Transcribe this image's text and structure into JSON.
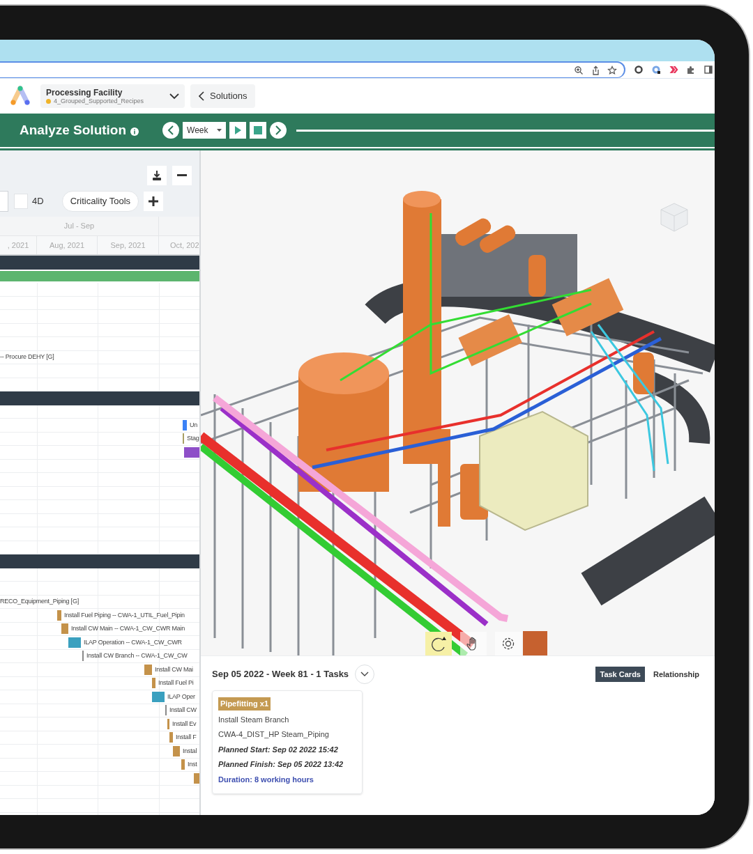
{
  "browser": {
    "omnibox_icons": [
      {
        "kind": "zoom"
      },
      {
        "kind": "share"
      },
      {
        "kind": "star"
      }
    ],
    "extensions": [
      {
        "kind": "ring"
      },
      {
        "kind": "profile"
      },
      {
        "kind": "arrows"
      },
      {
        "kind": "puzzle"
      },
      {
        "kind": "sidebar"
      }
    ]
  },
  "header": {
    "project_title": "Processing Facility",
    "project_subtitle": "4_Grouped_Supported_Recipes",
    "back_button": "Solutions"
  },
  "toolbar": {
    "title": "Analyze Solution",
    "period": "Week"
  },
  "gantt": {
    "view_checkbox": {
      "label": "4D",
      "checked": false
    },
    "criticality_button": "Criticality Tools",
    "quarter": "Jul - Sep",
    "months": [
      ", 2021",
      "Aug, 2021",
      "Sep, 2021",
      "Oct, 202"
    ],
    "rows": [
      {
        "kind": "group"
      },
      {
        "kind": "summary"
      },
      {
        "kind": "blank"
      },
      {
        "kind": "blank"
      },
      {
        "kind": "blank"
      },
      {
        "kind": "blank"
      },
      {
        "kind": "blank"
      },
      {
        "kind": "label",
        "label": "-- Procure DEHY [G]"
      },
      {
        "kind": "blank"
      },
      {
        "kind": "blank"
      },
      {
        "kind": "group"
      },
      {
        "kind": "blank"
      },
      {
        "kind": "task",
        "label": "Un",
        "color": "#3b82f6"
      },
      {
        "kind": "task",
        "label": "Stag",
        "color": "#a8a064"
      },
      {
        "kind": "task",
        "color": "#8e4fc8"
      },
      {
        "kind": "blank"
      },
      {
        "kind": "blank"
      },
      {
        "kind": "blank"
      },
      {
        "kind": "blank"
      },
      {
        "kind": "blank"
      },
      {
        "kind": "blank"
      },
      {
        "kind": "blank"
      },
      {
        "kind": "group"
      },
      {
        "kind": "blank"
      },
      {
        "kind": "blank"
      },
      {
        "kind": "label",
        "label": "RECO_Equipment_Piping [G]"
      },
      {
        "kind": "task",
        "label": "Install Fuel Piping -- CWA-1_UTIL_Fuel_Pipin",
        "color": "#c4924a"
      },
      {
        "kind": "task",
        "label": "Install CW Main -- CWA-1_CW_CWR Main",
        "color": "#c4924a"
      },
      {
        "kind": "task",
        "label": "ILAP Operation -- CWA-1_CW_CWR",
        "color": "#3aa0bf"
      },
      {
        "kind": "task",
        "label": "Install CW Branch -- CWA-1_CW_CW",
        "color": "#8a8a8a"
      },
      {
        "kind": "task",
        "label": "Install CW Mai",
        "color": "#c4924a"
      },
      {
        "kind": "task",
        "label": "Install Fuel Pi",
        "color": "#c4924a"
      },
      {
        "kind": "task",
        "label": "ILAP Oper",
        "color": "#3aa0bf"
      },
      {
        "kind": "task",
        "label": "Install CW",
        "color": "#8a8a8a"
      },
      {
        "kind": "task",
        "label": "Install Ev",
        "color": "#c4924a"
      },
      {
        "kind": "task",
        "label": "Install F",
        "color": "#c4924a"
      },
      {
        "kind": "task",
        "label": "Instal",
        "color": "#c4924a"
      },
      {
        "kind": "task",
        "label": "Inst",
        "color": "#c4924a"
      },
      {
        "kind": "task",
        "color": "#c4924a"
      },
      {
        "kind": "blank"
      },
      {
        "kind": "blank"
      }
    ]
  },
  "viewer": {
    "tools": [
      {
        "kind": "rotate",
        "selected": true
      },
      {
        "kind": "pan",
        "selected": false
      },
      {
        "kind": "settings",
        "selected": false
      }
    ]
  },
  "task_panel": {
    "heading": "Sep 05 2022 - Week 81 - 1 Tasks",
    "tabs": [
      {
        "label": "Task Cards",
        "selected": true
      },
      {
        "label": "Relationship",
        "selected": false
      }
    ],
    "cards": [
      {
        "tag": "Pipefitting x1",
        "name": "Install Steam Branch",
        "location": "CWA-4_DIST_HP Steam_Piping",
        "planned_start": "Planned Start: Sep 02 2022 15:42",
        "planned_finish": "Planned Finish: Sep 05 2022 13:42",
        "duration": "Duration: 8 working hours"
      }
    ]
  }
}
